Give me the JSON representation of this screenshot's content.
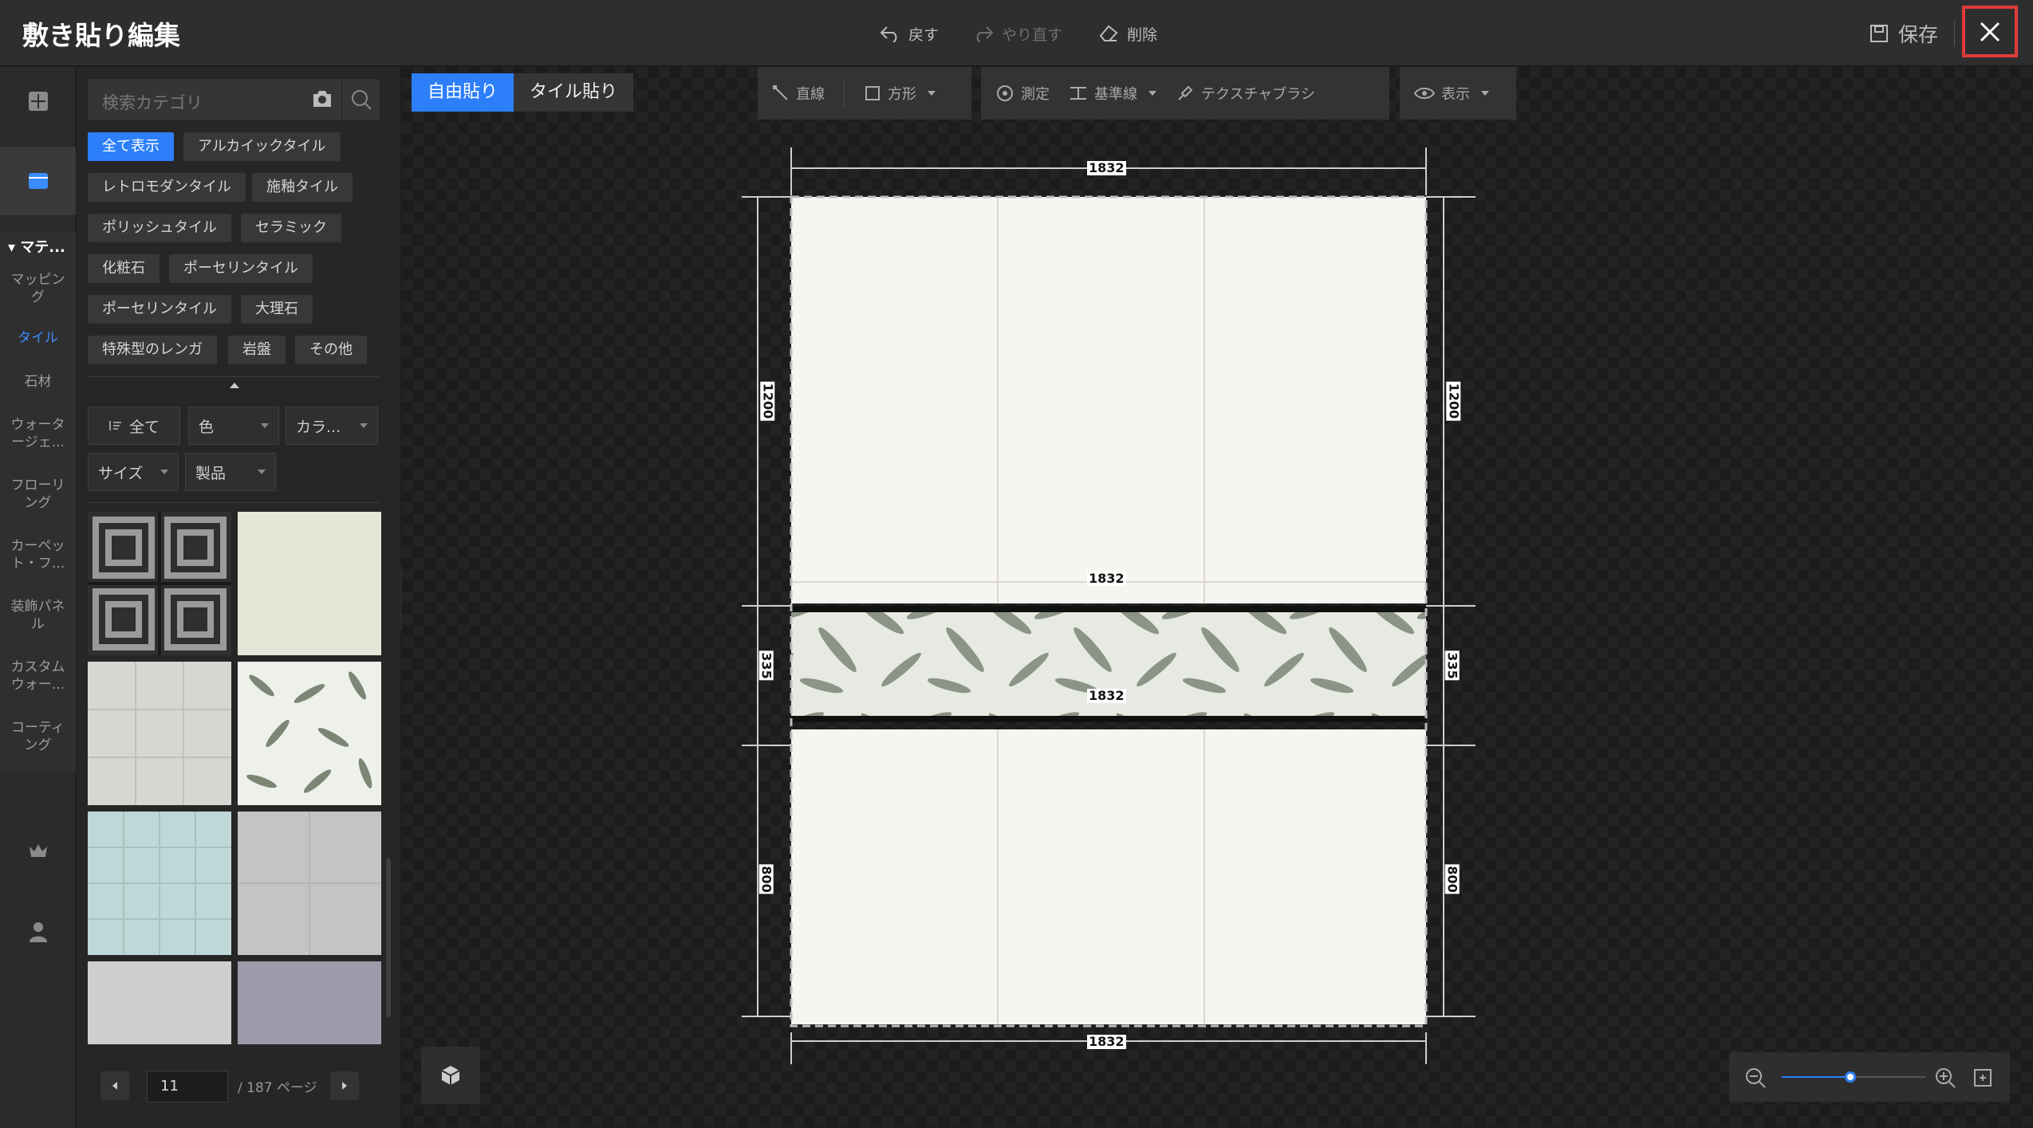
{
  "app": {
    "title": "敷き貼り編集",
    "accent": "#2d7ff9"
  },
  "topbar": {
    "undo": "戻す",
    "redo": "やり直す",
    "delete": "削除",
    "save": "保存"
  },
  "rail": {
    "group": "マテ...",
    "items": [
      "マッピング",
      "タイル",
      "石材",
      "ウォーター ージェ...",
      "フローリング",
      "カーペット・フ...",
      "装飾パネル",
      "カスタムウォー...",
      "コーティング"
    ],
    "item_lines": [
      [
        "マッピン",
        "グ"
      ],
      [
        "タイル"
      ],
      [
        "石材"
      ],
      [
        "ウォータ",
        "ージェ..."
      ],
      [
        "フローリ",
        "ング"
      ],
      [
        "カーペッ",
        "ト・フ..."
      ],
      [
        "装飾パネ",
        "ル"
      ],
      [
        "カスタム",
        "ウォー..."
      ],
      [
        "コーティ",
        "ング"
      ]
    ],
    "active_index": 1
  },
  "panel": {
    "search_placeholder": "検索カテゴリ",
    "chips": [
      "全て表示",
      "アルカイックタイル",
      "レトロモダンタイル",
      "施釉タイル",
      "ポリッシュタイル",
      "セラミック",
      "化粧石",
      "ポーセリンタイル",
      "ポーセリンタイル",
      "大理石",
      "特殊型のレンガ",
      "岩盤",
      "その他"
    ],
    "filters": {
      "all": "全て",
      "color": "色",
      "colour2": "カラ...",
      "size": "サイズ",
      "product": "製品"
    },
    "pager": {
      "current": "11",
      "total": "/ 187 ページ"
    }
  },
  "canvas": {
    "modes": [
      "自由貼り",
      "タイル貼り"
    ],
    "active_mode": 0,
    "tools": {
      "line": "直線",
      "rect": "方形",
      "measure": "測定",
      "guide": "基準線",
      "brush": "テクスチャブラシ",
      "view": "表示"
    },
    "dims": {
      "width": "1832",
      "h_top": "1200",
      "h_mid": "335",
      "h_bottom": "800"
    },
    "zoom_level": 0.48
  }
}
